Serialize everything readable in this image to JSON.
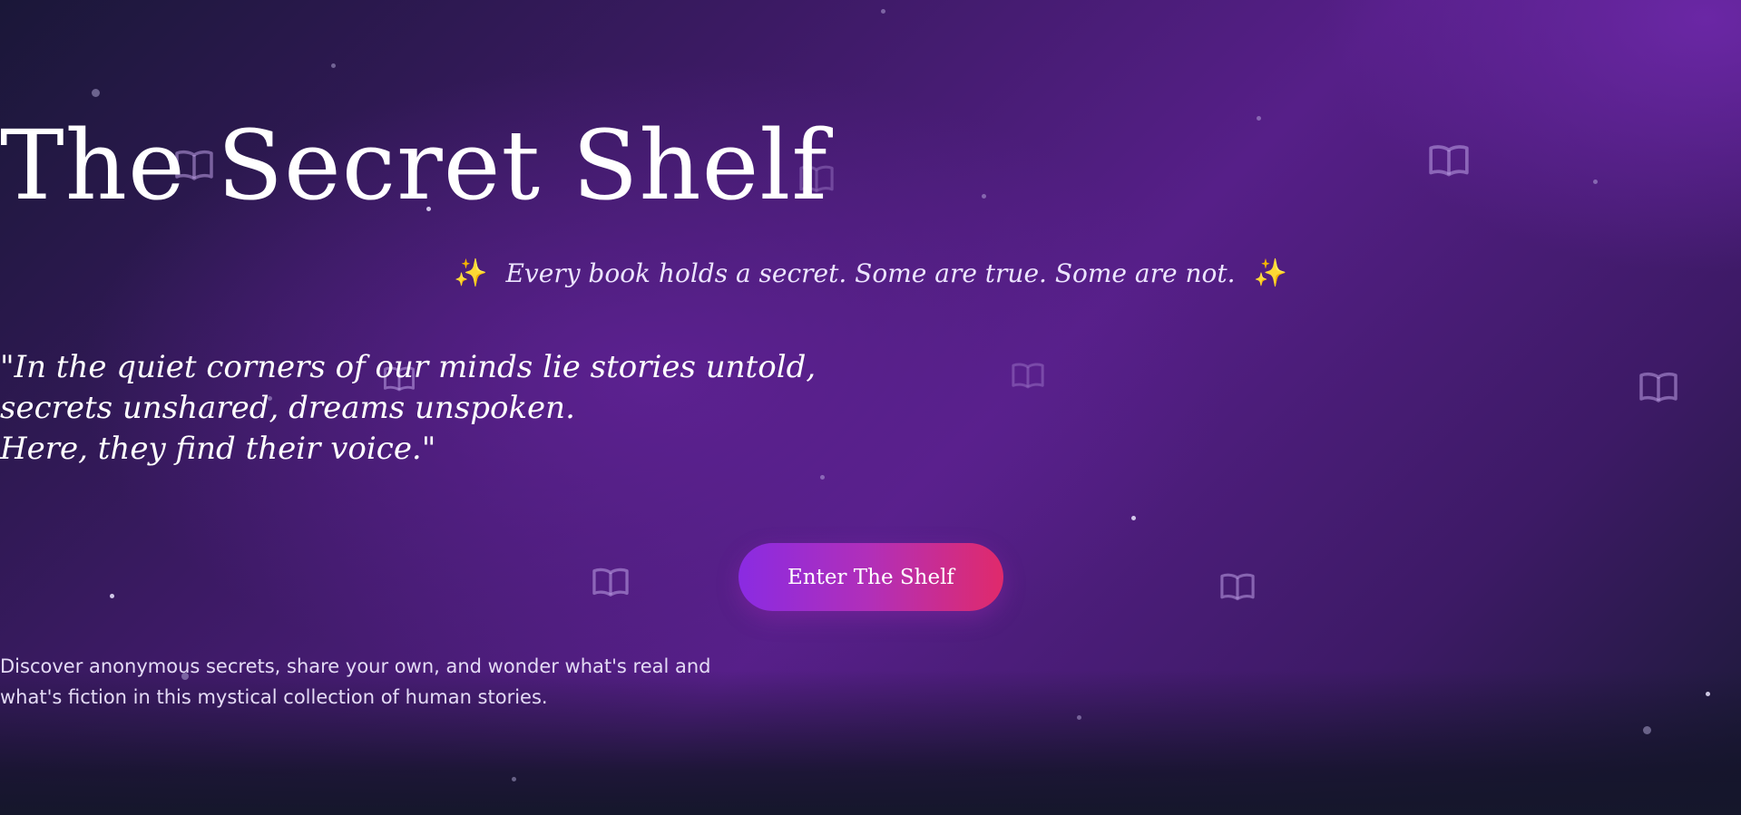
{
  "hero": {
    "title": "The Secret Shelf",
    "tagline": "Every book holds a secret. Some are true. Some are not.",
    "sparkle_glyph": "✨",
    "quote_lines": [
      "\"In the quiet corners of our minds lie stories untold,",
      "secrets unshared, dreams unspoken.",
      "Here, they find their voice.\""
    ],
    "cta_label": "Enter The Shelf",
    "description_lines": [
      "Discover anonymous secrets, share your own, and wonder what's real and",
      "what's fiction in this mystical collection of human stories."
    ]
  },
  "decor": {
    "icon": "open-book-icon",
    "accent_color": "#f6c945",
    "button_gradient": [
      "#8a2be2",
      "#e02a6b"
    ]
  }
}
